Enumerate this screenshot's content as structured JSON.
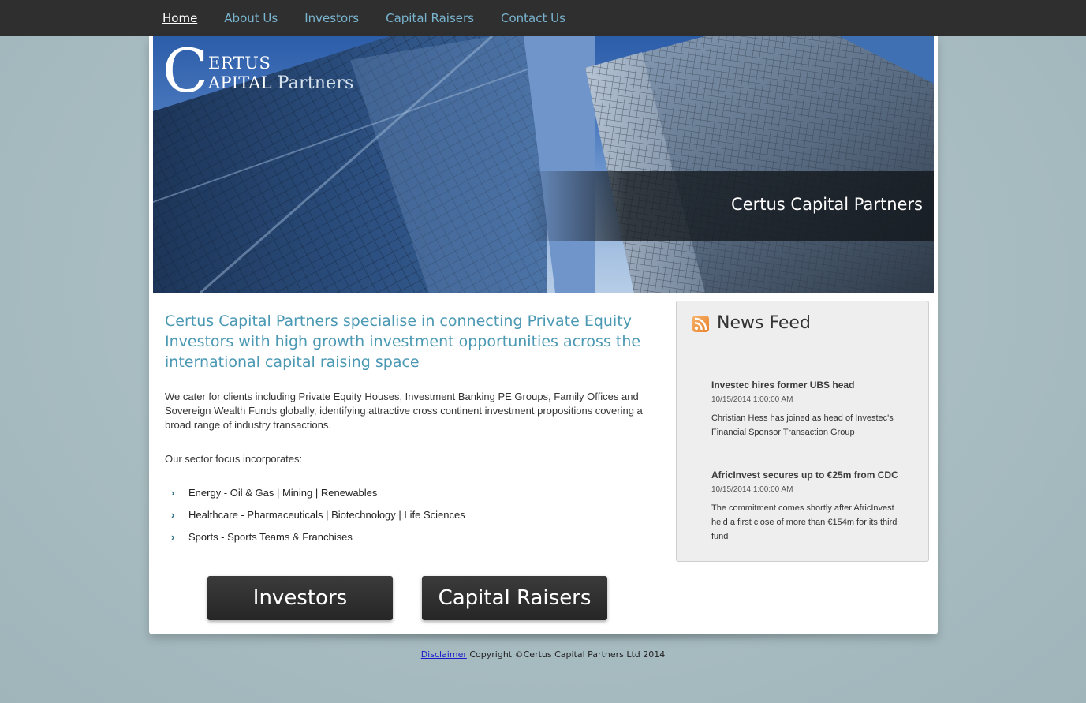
{
  "nav": {
    "items": [
      {
        "label": "Home",
        "active": true
      },
      {
        "label": "About Us",
        "active": false
      },
      {
        "label": "Investors",
        "active": false
      },
      {
        "label": "Capital Raisers",
        "active": false
      },
      {
        "label": "Contact Us",
        "active": false
      }
    ]
  },
  "logo": {
    "letter": "C",
    "line1": "ERTUS",
    "line2": "APITAL",
    "line2b": "Partners"
  },
  "hero": {
    "title": "Certus Capital Partners"
  },
  "intro": {
    "heading": "Certus Capital Partners specialise in connecting Private Equity Investors with high growth investment opportunities across the international capital raising space",
    "paragraph": "We cater for clients including Private Equity Houses, Investment Banking PE Groups, Family Offices and Sovereign Wealth Funds globally, identifying attractive cross continent investment propositions covering a broad range of industry transactions.",
    "focus_label": "Our sector focus incorporates:",
    "sectors": [
      "Energy - Oil & Gas | Mining | Renewables",
      "Healthcare - Pharmaceuticals | Biotechnology | Life Sciences",
      "Sports - Sports Teams & Franchises"
    ]
  },
  "buttons": {
    "investors": "Investors",
    "capital_raisers": "Capital Raisers"
  },
  "news": {
    "title": "News Feed",
    "items": [
      {
        "title": "Investec hires former UBS head",
        "date": "10/15/2014 1:00:00 AM",
        "summary": "Christian Hess has joined as head of Investec's Financial Sponsor Transaction Group"
      },
      {
        "title": "AfricInvest secures up to €25m from CDC",
        "date": "10/15/2014 1:00:00 AM",
        "summary": "The commitment comes shortly after AfricInvest held a first close of more than €154m for its third fund"
      }
    ]
  },
  "footer": {
    "link": "Disclaimer",
    "text": " Copyright ©Certus Capital Partners Ltd 2014"
  },
  "colors": {
    "nav_bg": "#2f2f2f",
    "nav_link": "#79b4cf",
    "heading_blue": "#4a98b3",
    "page_bg": "#a7bcc2",
    "button_bg": "#2b2b2b"
  }
}
